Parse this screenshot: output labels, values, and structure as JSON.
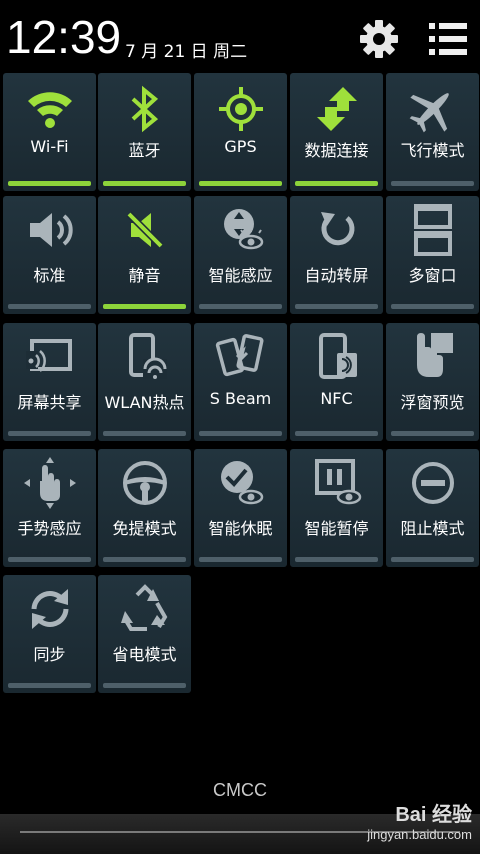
{
  "header": {
    "time": "12:39",
    "date": "7 月 21 日 周二",
    "settings_icon": "gear-icon",
    "menu_icon": "list-icon"
  },
  "colors": {
    "active_bar": "#8dd33a",
    "inactive_bar": "#4e5f69",
    "active_icon": "#9fe03b",
    "inactive_icon": "#aab4ba",
    "tile_bg": "#1d2d36"
  },
  "tiles": [
    {
      "label": "Wi-Fi",
      "icon": "wifi-icon",
      "active": true
    },
    {
      "label": "蓝牙",
      "icon": "bluetooth-icon",
      "active": true
    },
    {
      "label": "GPS",
      "icon": "gps-icon",
      "active": true
    },
    {
      "label": "数据连接",
      "icon": "data-transfer-icon",
      "active": true
    },
    {
      "label": "飞行模式",
      "icon": "airplane-icon",
      "active": false
    },
    {
      "label": "标准",
      "icon": "speaker-icon",
      "active": false
    },
    {
      "label": "静音",
      "icon": "mute-icon",
      "active": true
    },
    {
      "label": "智能感应",
      "icon": "smart-sensor-icon",
      "active": false
    },
    {
      "label": "自动转屏",
      "icon": "rotate-icon",
      "active": false
    },
    {
      "label": "多窗口",
      "icon": "multi-window-icon",
      "active": false
    },
    {
      "label": "屏幕共享",
      "icon": "screen-mirror-icon",
      "active": false
    },
    {
      "label": "WLAN热点",
      "icon": "hotspot-icon",
      "active": false
    },
    {
      "label": "S Beam",
      "icon": "sbeam-icon",
      "active": false
    },
    {
      "label": "NFC",
      "icon": "nfc-icon",
      "active": false
    },
    {
      "label": "浮窗预览",
      "icon": "air-view-icon",
      "active": false
    },
    {
      "label": "手势感应",
      "icon": "gesture-icon",
      "active": false
    },
    {
      "label": "免提模式",
      "icon": "steering-wheel-icon",
      "active": false
    },
    {
      "label": "智能休眠",
      "icon": "smart-stay-icon",
      "active": false
    },
    {
      "label": "智能暂停",
      "icon": "smart-pause-icon",
      "active": false
    },
    {
      "label": "阻止模式",
      "icon": "block-icon",
      "active": false
    },
    {
      "label": "同步",
      "icon": "sync-icon",
      "active": false
    },
    {
      "label": "省电模式",
      "icon": "recycle-icon",
      "active": false
    }
  ],
  "footer": {
    "carrier": "CMCC",
    "watermark_logo": "Bai 经验",
    "watermark_url": "jingyan.baidu.com"
  }
}
